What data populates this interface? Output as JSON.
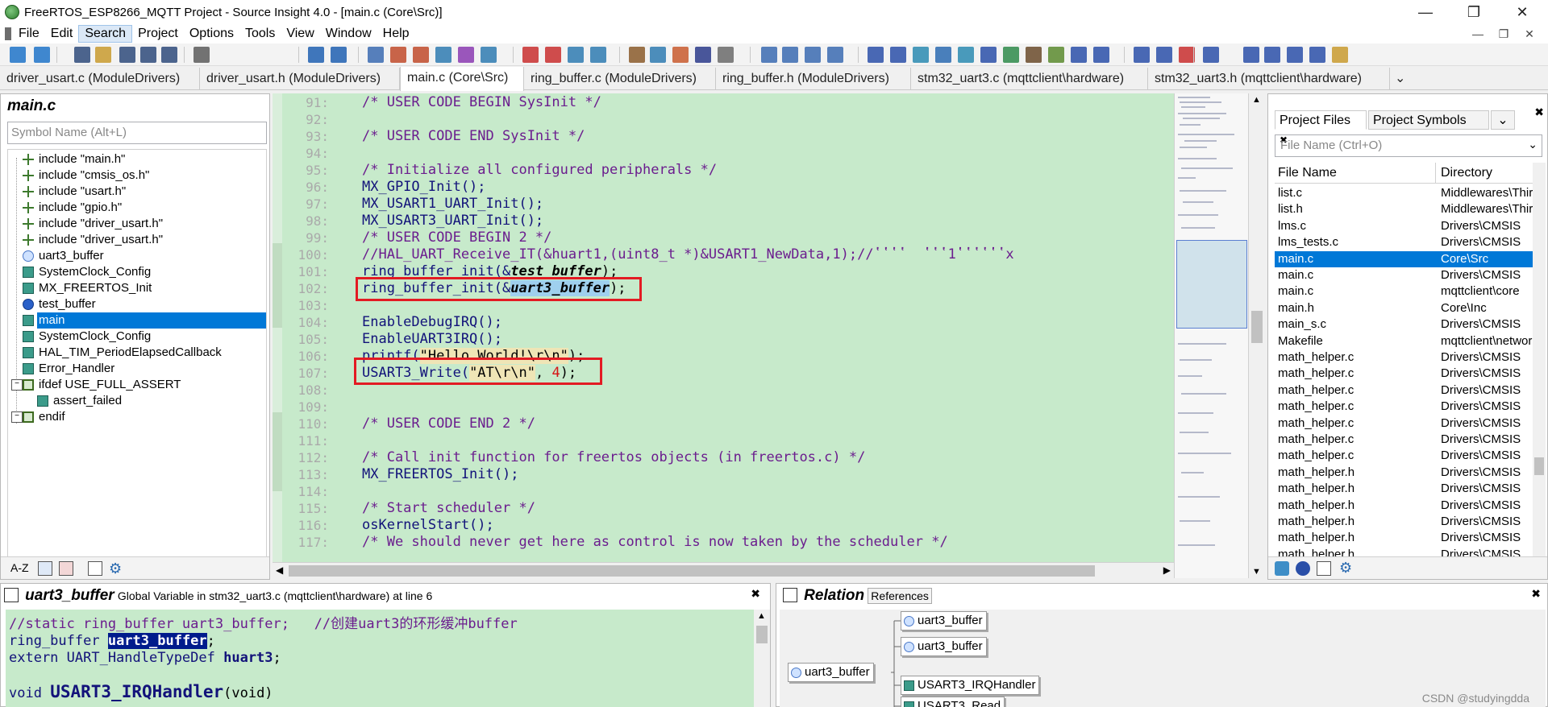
{
  "window": {
    "title": "FreeRTOS_ESP8266_MQTT Project - Source Insight 4.0 - [main.c (Core\\Src)]"
  },
  "menu": [
    "File",
    "Edit",
    "Search",
    "Project",
    "Options",
    "Tools",
    "View",
    "Window",
    "Help"
  ],
  "menu_active": "Search",
  "tabs": [
    "driver_usart.c (ModuleDrivers)",
    "driver_usart.h (ModuleDrivers)",
    "main.c (Core\\Src)",
    "ring_buffer.c (ModuleDrivers)",
    "ring_buffer.h (ModuleDrivers)",
    "stm32_uart3.c (mqttclient\\hardware)",
    "stm32_uart3.h (mqttclient\\hardware)"
  ],
  "active_tab": "main.c (Core\\Src)",
  "symbol_panel": {
    "title": "main.c",
    "search_placeholder": "Symbol Name (Alt+L)",
    "items": [
      {
        "label": "include \"main.h\"",
        "icon": "include-icon"
      },
      {
        "label": "include \"cmsis_os.h\"",
        "icon": "include-icon"
      },
      {
        "label": "include \"usart.h\"",
        "icon": "include-icon"
      },
      {
        "label": "include \"gpio.h\"",
        "icon": "include-icon"
      },
      {
        "label": "include \"driver_usart.h\"",
        "icon": "include-icon"
      },
      {
        "label": "include \"driver_usart.h\"",
        "icon": "include-icon"
      },
      {
        "label": "uart3_buffer",
        "icon": "global-variable-icon"
      },
      {
        "label": "SystemClock_Config",
        "icon": "function-icon"
      },
      {
        "label": "MX_FREERTOS_Init",
        "icon": "function-icon"
      },
      {
        "label": "test_buffer",
        "icon": "variable-icon"
      },
      {
        "label": "main",
        "icon": "function-icon",
        "selected": true
      },
      {
        "label": "SystemClock_Config",
        "icon": "function-icon"
      },
      {
        "label": "HAL_TIM_PeriodElapsedCallback",
        "icon": "function-icon"
      },
      {
        "label": "Error_Handler",
        "icon": "function-icon"
      },
      {
        "label": "ifdef USE_FULL_ASSERT",
        "icon": "hash-icon"
      },
      {
        "label": "assert_failed",
        "icon": "function-icon",
        "indent": true
      },
      {
        "label": "endif",
        "icon": "hash-icon"
      }
    ]
  },
  "code": {
    "lines": [
      {
        "n": "91:",
        "text": "/* USER CODE BEGIN SysInit */",
        "cls": "cm"
      },
      {
        "n": "92:",
        "text": ""
      },
      {
        "n": "93:",
        "text": "/* USER CODE END SysInit */",
        "cls": "cm"
      },
      {
        "n": "94:",
        "text": ""
      },
      {
        "n": "95:",
        "text": "/* Initialize all configured peripherals */",
        "cls": "cm"
      },
      {
        "n": "96:",
        "text": "MX_GPIO_Init();",
        "cls": "fn"
      },
      {
        "n": "97:",
        "text": "MX_USART1_UART_Init();",
        "cls": "fn"
      },
      {
        "n": "98:",
        "text": "MX_USART3_UART_Init();",
        "cls": "fn"
      },
      {
        "n": "99:",
        "text": "/* USER CODE BEGIN 2 */",
        "cls": "cm"
      },
      {
        "n": "100:",
        "text": "//HAL_UART_Receive_IT(&huart1,(uint8_t *)&USART1_NewData,1);//ʽʽʽʽ  ʽʽʽ1ʽʽʽʽʽʽх",
        "cls": "cm"
      },
      {
        "n": "101:",
        "pre": "ring_buffer_init(&",
        "it": "test_buffer",
        "post": ");"
      },
      {
        "n": "102:",
        "pre": "ring_buffer_init(&",
        "it": "uart3_buffer",
        "post": ");"
      },
      {
        "n": "103:",
        "text": ""
      },
      {
        "n": "104:",
        "text": "EnableDebugIRQ();",
        "cls": "fn"
      },
      {
        "n": "105:",
        "text": "EnableUART3IRQ();",
        "cls": "fn"
      },
      {
        "n": "106:",
        "pre": "printf(",
        "str": "\"Hello World!\\r\\n\"",
        "post": ");"
      },
      {
        "n": "107:",
        "pre": "USART3_Write(",
        "str": "\"AT\\r\\n\"",
        "mid": ", ",
        "num": "4",
        "post": ");"
      },
      {
        "n": "108:",
        "text": ""
      },
      {
        "n": "109:",
        "text": ""
      },
      {
        "n": "110:",
        "text": "/* USER CODE END 2 */",
        "cls": "cm"
      },
      {
        "n": "111:",
        "text": ""
      },
      {
        "n": "112:",
        "text": "/* Call init function for freertos objects (in freertos.c) */",
        "cls": "cm"
      },
      {
        "n": "113:",
        "text": "MX_FREERTOS_Init();",
        "cls": "fn"
      },
      {
        "n": "114:",
        "text": ""
      },
      {
        "n": "115:",
        "text": "/* Start scheduler */",
        "cls": "cm"
      },
      {
        "n": "116:",
        "text": "osKernelStart();",
        "cls": "fn"
      },
      {
        "n": "117:",
        "text": "/* We should never get here as control is now taken by the scheduler */",
        "cls": "cm"
      }
    ]
  },
  "project_panel": {
    "tabs": [
      "Project Files",
      "Project Symbols"
    ],
    "search_placeholder": "File Name (Ctrl+O)",
    "columns": [
      "File Name",
      "Directory"
    ],
    "rows": [
      [
        "list.c",
        "Middlewares\\Third_Party"
      ],
      [
        "list.h",
        "Middlewares\\Third_Party"
      ],
      [
        "lms.c",
        "Drivers\\CMSIS"
      ],
      [
        "lms_tests.c",
        "Drivers\\CMSIS"
      ],
      [
        "main.c",
        "Core\\Src"
      ],
      [
        "main.c",
        "Drivers\\CMSIS"
      ],
      [
        "main.c",
        "mqttclient\\core"
      ],
      [
        "main.h",
        "Core\\Inc"
      ],
      [
        "main_s.c",
        "Drivers\\CMSIS"
      ],
      [
        "Makefile",
        "mqttclient\\network"
      ],
      [
        "math_helper.c",
        "Drivers\\CMSIS"
      ],
      [
        "math_helper.c",
        "Drivers\\CMSIS"
      ],
      [
        "math_helper.c",
        "Drivers\\CMSIS"
      ],
      [
        "math_helper.c",
        "Drivers\\CMSIS"
      ],
      [
        "math_helper.c",
        "Drivers\\CMSIS"
      ],
      [
        "math_helper.c",
        "Drivers\\CMSIS"
      ],
      [
        "math_helper.c",
        "Drivers\\CMSIS"
      ],
      [
        "math_helper.h",
        "Drivers\\CMSIS"
      ],
      [
        "math_helper.h",
        "Drivers\\CMSIS"
      ],
      [
        "math_helper.h",
        "Drivers\\CMSIS"
      ],
      [
        "math_helper.h",
        "Drivers\\CMSIS"
      ],
      [
        "math_helper.h",
        "Drivers\\CMSIS"
      ],
      [
        "math_helper.h",
        "Drivers\\CMSIS"
      ]
    ],
    "selected_index": 4
  },
  "context_panel": {
    "symbol": "uart3_buffer",
    "desc": "Global Variable in stm32_uart3.c (mqttclient\\hardware) at line 6",
    "lines": [
      {
        "pre": "//static ring_buffer uart3_buffer;   //创建uart3的环形缓冲buffer",
        "cls": "cm"
      },
      {
        "pre": "ring_buffer ",
        "hl": "uart3_buffer",
        "post": ";"
      },
      {
        "pre": "extern UART_HandleTypeDef ",
        "bold": "huart3",
        "post": ";"
      },
      {
        "pre": ""
      },
      {
        "pre": "void ",
        "big": "USART3_IRQHandler",
        "post": "(void)"
      }
    ]
  },
  "relation_panel": {
    "title": "Relation",
    "subtitle": "References",
    "root": "uart3_buffer",
    "children": [
      "uart3_buffer",
      "uart3_buffer",
      "USART3_IRQHandler",
      "USART3_Read"
    ]
  },
  "watermark": "CSDN @studyingdda"
}
